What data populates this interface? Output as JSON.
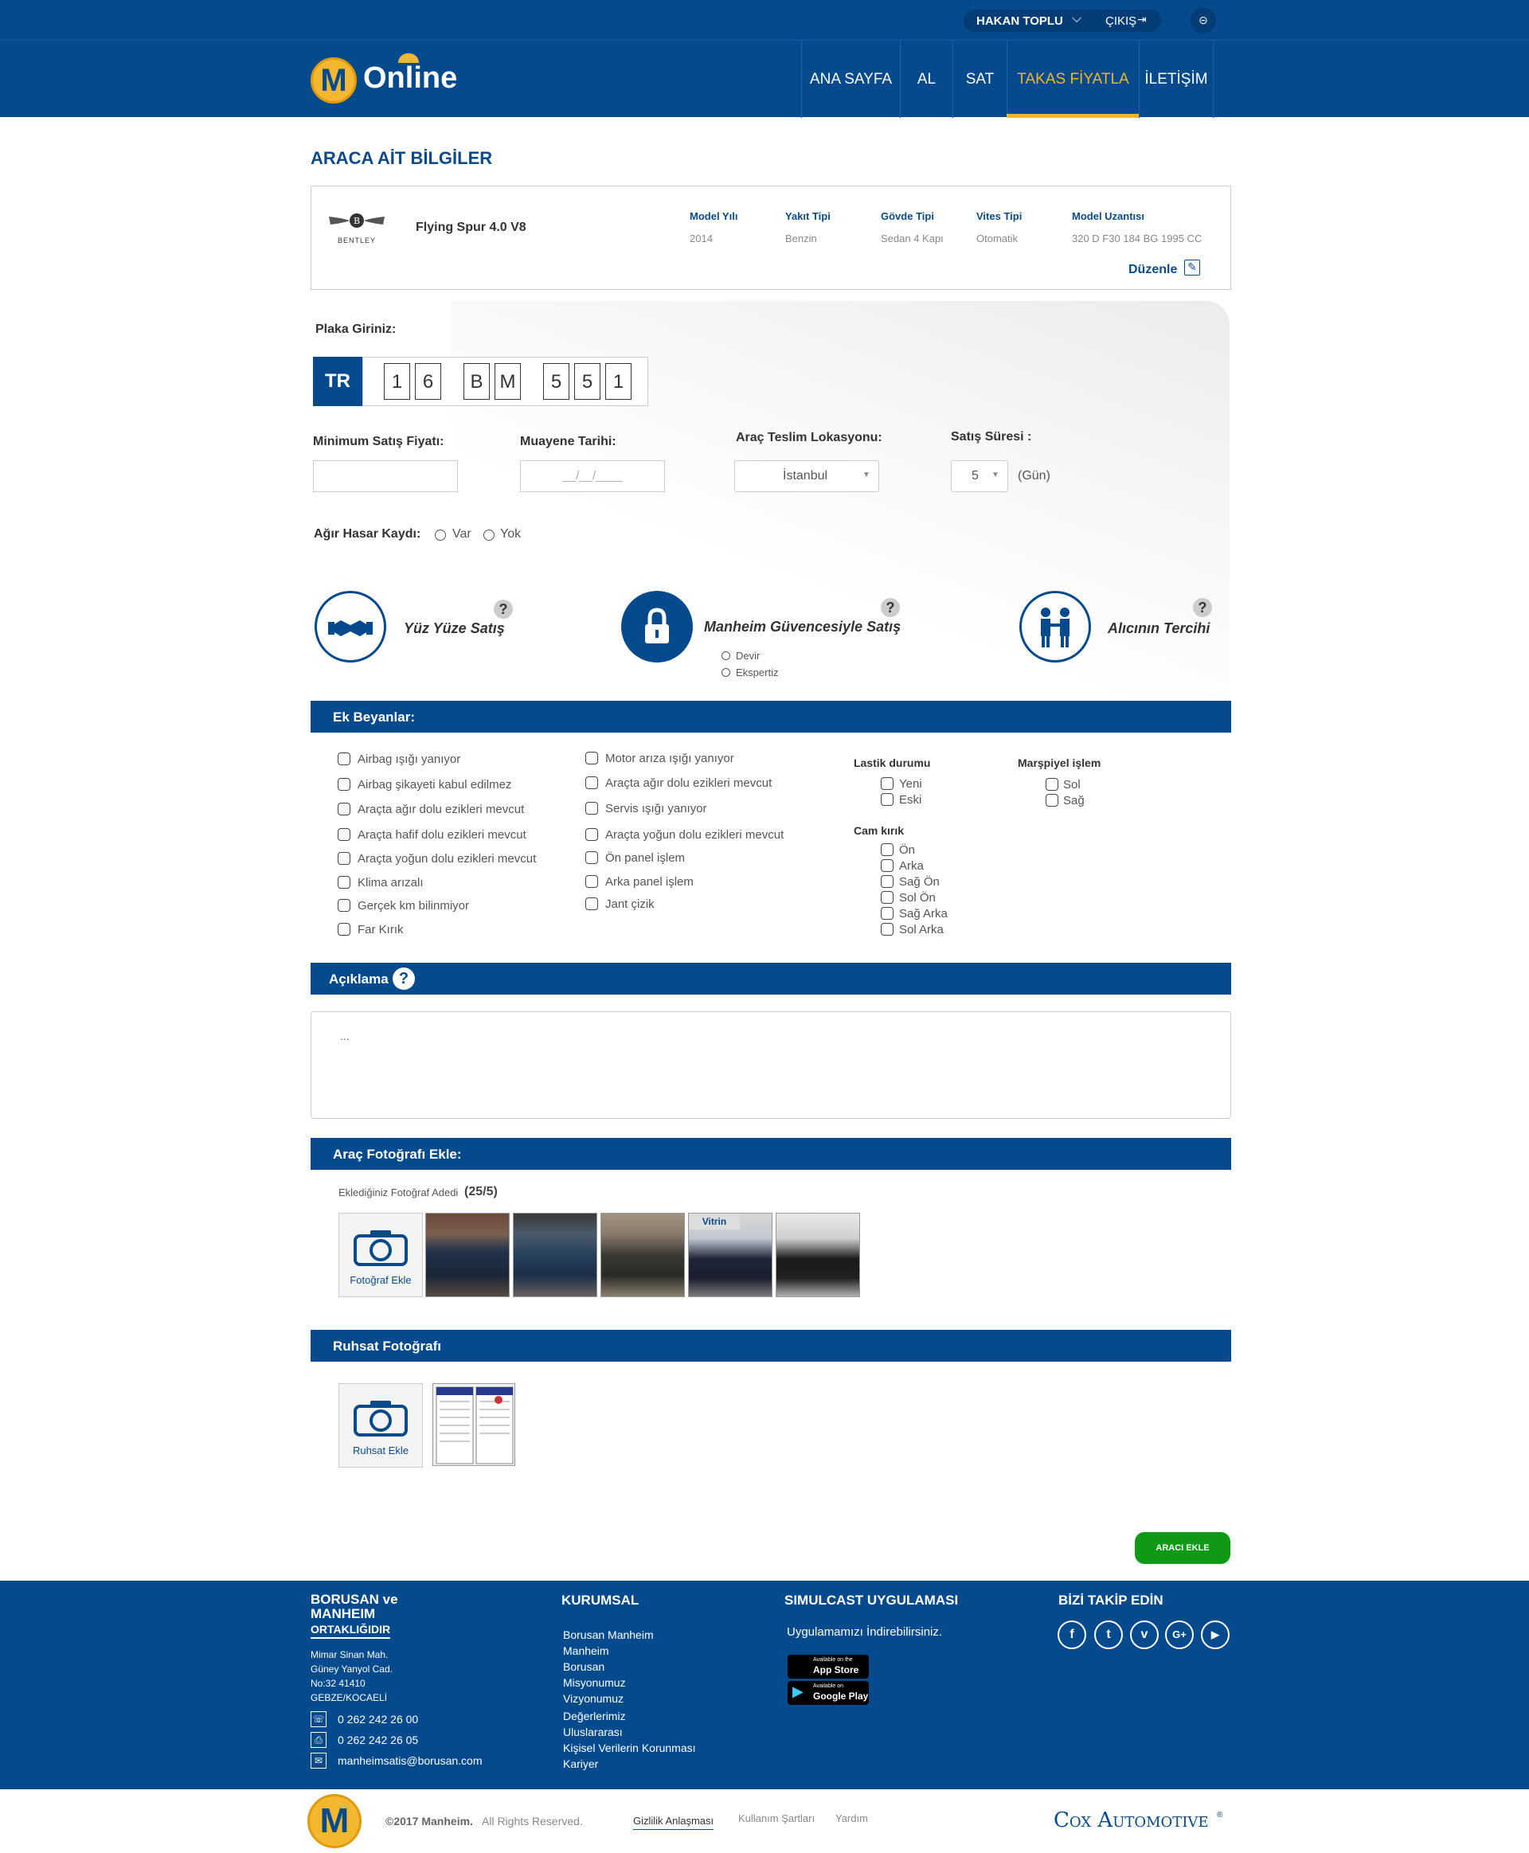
{
  "header": {
    "user_name": "HAKAN TOPLU",
    "logout": "ÇIKIŞ",
    "logo_text": "Online",
    "logo_letter": "M",
    "nav": [
      "ANA SAYFA",
      "AL",
      "SAT",
      "TAKAS FİYATLA",
      "İLETİŞİM"
    ]
  },
  "vehicle": {
    "section_title": "ARACA AİT BİLGİLER",
    "brand_label": "BENTLEY",
    "model": "Flying Spur 4.0 V8",
    "specs": [
      {
        "label": "Model Yılı",
        "value": "2014"
      },
      {
        "label": "Yakıt Tipi",
        "value": "Benzin"
      },
      {
        "label": "Gövde Tipi",
        "value": "Sedan 4 Kapı"
      },
      {
        "label": "Vites Tipi",
        "value": "Otomatik"
      },
      {
        "label": "Model Uzantısı",
        "value": "320 D F30 184 BG 1995 CC"
      }
    ],
    "edit": "Düzenle"
  },
  "form": {
    "plate_label": "Plaka Giriniz:",
    "plate_country": "TR",
    "plate_chars": [
      "1",
      "6",
      "B",
      "M",
      "5",
      "5",
      "1"
    ],
    "min_price_label": "Minimum Satış Fiyatı:",
    "min_price_value": "",
    "inspection_label": "Muayene Tarihi:",
    "inspection_placeholder": "__/__/____",
    "location_label": "Araç Teslim Lokasyonu:",
    "location_value": "İstanbul",
    "duration_label": "Satış Süresi :",
    "duration_value": "5",
    "duration_unit": "(Gün)",
    "damage_label": "Ağır Hasar Kaydı:",
    "damage_options": [
      "Var",
      "Yok"
    ]
  },
  "sale_options": {
    "face_to_face": "Yüz Yüze Satış",
    "guarantee": "Manheim Güvencesiyle Satış",
    "guarantee_sub": [
      "Devir",
      "Ekspertiz"
    ],
    "buyer_choice": "Alıcının Tercihi",
    "help": "?"
  },
  "declarations": {
    "title": "Ek Beyanlar:",
    "col1": [
      "Airbag ışığı yanıyor",
      "Airbag şikayeti kabul edilmez",
      "Araçta ağır dolu ezikleri mevcut",
      "Araçta hafif dolu ezikleri mevcut",
      "Araçta yoğun dolu ezikleri mevcut",
      "Klima arızalı",
      "Gerçek km bilinmiyor",
      "Far Kırık"
    ],
    "col2": [
      "Motor arıza ışığı yanıyor",
      "Araçta ağır dolu ezikleri mevcut",
      "Servis ışığı yanıyor",
      "Araçta yoğun dolu ezikleri mevcut",
      "Ön panel işlem",
      "Arka panel işlem",
      "Jant çizik"
    ],
    "tire_title": "Lastik durumu",
    "tire": [
      "Yeni",
      "Eski"
    ],
    "glass_title": "Cam kırık",
    "glass": [
      "Ön",
      "Arka",
      "Sağ Ön",
      "Sol Ön",
      "Sağ Arka",
      "Sol Arka"
    ],
    "mirror_title": "Marşpiyel işlem",
    "mirror": [
      "Sol",
      "Sağ"
    ]
  },
  "description": {
    "title": "Açıklama",
    "help": "?",
    "value": "..."
  },
  "photos": {
    "title": "Araç Fotoğrafı Ekle:",
    "count_label": "Eklediğiniz Fotoğraf Adedi",
    "count_value": "(25/5)",
    "add_label": "Fotoğraf Ekle",
    "showcase_badge": "Vitrin"
  },
  "license": {
    "title": "Ruhsat Fotoğrafı",
    "add_label": "Ruhsat Ekle"
  },
  "submit": "ARACI EKLE",
  "footer": {
    "partner_title_1": "BORUSAN ve",
    "partner_title_2": "MANHEIM",
    "partner_title_3": "ORTAKLIĞIDIR",
    "address": [
      "Mimar Sinan Mah.",
      "Güney Yanyol Cad.",
      "No:32 41410",
      "GEBZE/KOCAELİ"
    ],
    "phone": "0 262 242 26 00",
    "fax": "0 262 242 26 05",
    "email": "manheimsatis@borusan.com",
    "corporate_title": "KURUMSAL",
    "corporate_links": [
      "Borusan Manheim",
      "Manheim",
      "Borusan",
      "Misyonumuz",
      "Vizyonumuz",
      "Değerlerimiz",
      "Uluslararası",
      "Kişisel Verilerin Korunması",
      "Kariyer"
    ],
    "app_title": "SIMULCAST UYGULAMASI",
    "app_text": "Uygulamamızı İndirebilirsiniz.",
    "appstore_small": "Available on the",
    "appstore": "App Store",
    "googleplay_small": "Available on",
    "googleplay": "Google Play",
    "follow_title": "BİZİ TAKİP EDİN",
    "social": [
      "f",
      "t",
      "v",
      "G+",
      "▶"
    ]
  },
  "bottom": {
    "copyright_bold": "©2017 Manheim.",
    "copyright": "All Rights Reserved.",
    "links": [
      "Gizlilik Anlaşması",
      "Kullanım Şartları",
      "Yardım"
    ],
    "cox": "Cox Automotive",
    "tm": "®"
  }
}
